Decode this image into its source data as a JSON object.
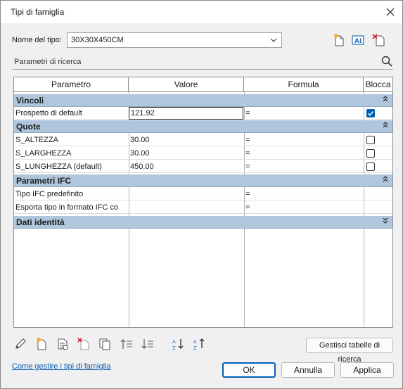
{
  "window": {
    "title": "Tipi di famiglia"
  },
  "type_selector": {
    "label": "Nome del tipo:",
    "value": "30X30X450CM"
  },
  "search": {
    "placeholder": "Parametri di ricerca"
  },
  "table": {
    "headers": [
      "Parametro",
      "Valore",
      "Formula",
      "Blocca"
    ],
    "groups": [
      {
        "name": "Vincoli",
        "rows": [
          {
            "param": "Prospetto di default",
            "value": "121.92",
            "formula": "=",
            "locked": true
          }
        ]
      },
      {
        "name": "Quote",
        "rows": [
          {
            "param": "S_ALTEZZA",
            "value": "30.00",
            "formula": "=",
            "locked": false
          },
          {
            "param": "S_LARGHEZZA",
            "value": "30.00",
            "formula": "=",
            "locked": false
          },
          {
            "param": "S_LUNGHEZZA (default)",
            "value": "450.00",
            "formula": "=",
            "locked": false
          }
        ]
      },
      {
        "name": "Parametri IFC",
        "rows": [
          {
            "param": "Tipo IFC predefinito",
            "value": "",
            "formula": "="
          },
          {
            "param": "Esporta tipo in formato IFC co",
            "value": "",
            "formula": "="
          }
        ]
      },
      {
        "name": "Dati identità",
        "rows": []
      }
    ]
  },
  "buttons": {
    "manage_lookup": "Gestisci tabelle di ricerca",
    "ok": "OK",
    "cancel": "Annulla",
    "apply": "Applica"
  },
  "help_link": "Come gestire i tipi di famiglia",
  "colors": {
    "group_header": "#afc6dd",
    "accent": "#005fb8",
    "link": "#0a5fb4"
  }
}
